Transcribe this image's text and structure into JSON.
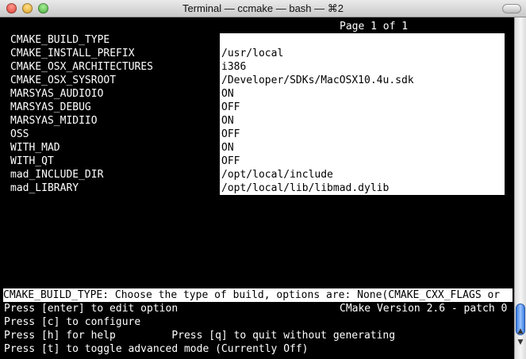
{
  "window": {
    "title": "Terminal — ccmake — bash — ⌘2"
  },
  "header": {
    "page_info": "Page 1 of 1"
  },
  "options": [
    {
      "name": "CMAKE_BUILD_TYPE",
      "value": ""
    },
    {
      "name": "CMAKE_INSTALL_PREFIX",
      "value": "/usr/local"
    },
    {
      "name": "CMAKE_OSX_ARCHITECTURES",
      "value": "i386"
    },
    {
      "name": "CMAKE_OSX_SYSROOT",
      "value": "/Developer/SDKs/MacOSX10.4u.sdk"
    },
    {
      "name": "MARSYAS_AUDIOIO",
      "value": "ON"
    },
    {
      "name": "MARSYAS_DEBUG",
      "value": "OFF"
    },
    {
      "name": "MARSYAS_MIDIIO",
      "value": "ON"
    },
    {
      "name": "OSS",
      "value": "OFF"
    },
    {
      "name": "WITH_MAD",
      "value": "ON"
    },
    {
      "name": "WITH_QT",
      "value": "OFF"
    },
    {
      "name": "mad_INCLUDE_DIR",
      "value": "/opt/local/include"
    },
    {
      "name": "mad_LIBRARY",
      "value": "/opt/local/lib/libmad.dylib"
    }
  ],
  "status": {
    "description": "CMAKE_BUILD_TYPE: Choose the type of build, options are: None(CMAKE_CXX_FLAGS or",
    "version": "CMake Version 2.6 - patch 0"
  },
  "help": [
    "Press [enter] to edit option",
    "Press [c] to configure",
    "Press [h] for help         Press [q] to quit without generating",
    "Press [t] to toggle advanced mode (Currently Off)"
  ],
  "colors": {
    "terminal_bg": "#000000",
    "terminal_fg": "#ffffff",
    "highlight_bg": "#ffffff"
  }
}
